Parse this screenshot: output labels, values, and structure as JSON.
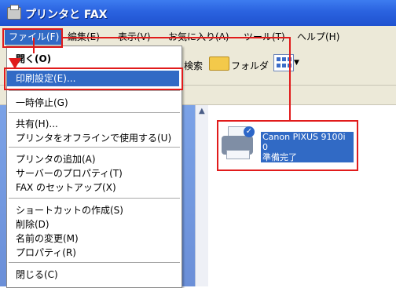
{
  "window": {
    "title": "プリンタと FAX"
  },
  "menubar": {
    "items": [
      "ファイル(F)",
      "編集(E)",
      "表示(V)",
      "お気に入り(A)",
      "ツール(T)",
      "ヘルプ(H)"
    ]
  },
  "toolbar": {
    "search_label": "検索",
    "folder_label": "フォルダ"
  },
  "file_menu": {
    "open": "開く(O)",
    "print_settings": "印刷設定(E)...",
    "pause": "一時停止(G)",
    "share": "共有(H)...",
    "use_offline": "プリンタをオフラインで使用する(U)",
    "add_printer": "プリンタの追加(A)",
    "server_properties": "サーバーのプロパティ(T)",
    "fax_setup": "FAX のセットアップ(X)",
    "create_shortcut": "ショートカットの作成(S)",
    "delete": "削除(D)",
    "rename": "名前の変更(M)",
    "properties": "プロパティ(R)",
    "close": "閉じる(C)"
  },
  "printer": {
    "name": "Canon PIXUS 9100i",
    "jobs": "0",
    "status": "準備完了"
  },
  "colors": {
    "highlight": "#316ac5",
    "annotation": "#e11b1b"
  }
}
